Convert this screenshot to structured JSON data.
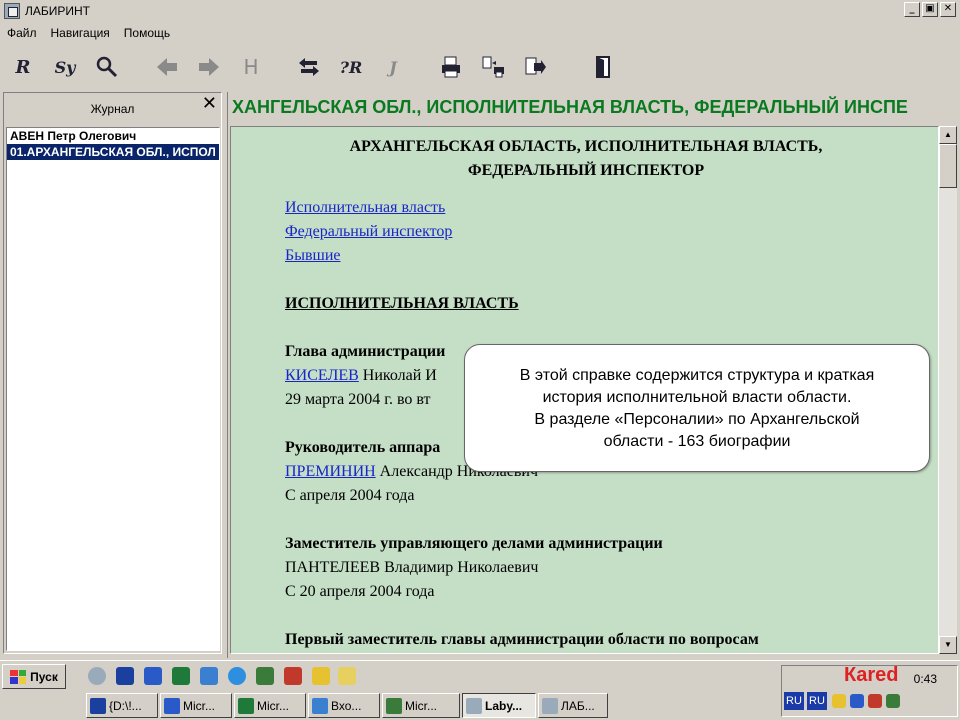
{
  "window": {
    "title": "ЛАБИРИНТ",
    "min": "_",
    "max": "▣",
    "close": "✕"
  },
  "menu": [
    "Файл",
    "Навигация",
    "Помощь"
  ],
  "toolbar": {
    "r": "R",
    "sy": "Sy",
    "h": "H",
    "qr": "?R",
    "j": "J"
  },
  "journal": {
    "title": "Журнал",
    "close": "✕",
    "items": [
      "АВЕН Петр Олегович",
      "01.АРХАНГЕЛЬСКАЯ ОБЛ., ИСПОЛ"
    ]
  },
  "header_text": "ХАНГЕЛЬСКАЯ ОБЛ., ИСПОЛНИТЕЛЬНАЯ ВЛАСТЬ, ФЕДЕРАЛЬНЫЙ ИНСПЕ",
  "document": {
    "title_line1": "АРХАНГЕЛЬСКАЯ ОБЛАСТЬ, ИСПОЛНИТЕЛЬНАЯ ВЛАСТЬ,",
    "title_line2": "ФЕДЕРАЛЬНЫЙ ИНСПЕКТОР",
    "links": [
      "Исполнительная власть",
      "Федеральный инспектор",
      "Бывшие"
    ],
    "section": "ИСПОЛНИТЕЛЬНАЯ ВЛАСТЬ",
    "entries": [
      {
        "role": "Глава администрации",
        "surname": "КИСЕЛЕВ",
        "name": " Николай И",
        "date": "29 марта 2004 г. во вт"
      },
      {
        "role": "Руководитель аппара",
        "surname": "ПРЕМИНИН",
        "name": " Александр Николаевич",
        "date": "С апреля 2004 года"
      },
      {
        "role": "Заместитель управляющего делами администрации",
        "surname": "ПАНТЕЛЕЕВ",
        "name": " Владимир Николаевич",
        "date": "С 20 апреля 2004 года"
      }
    ],
    "last_role": "Первый заместитель главы администрации области по вопросам"
  },
  "callout": [
    "В этой справке содержится структура и краткая",
    "история исполнительной власти области.",
    "В разделе «Персоналии» по Архангельской",
    "области - 163 биографии"
  ],
  "taskbar": {
    "start": "Пуск",
    "tasks": [
      "{D:\\!...",
      "Micr...",
      "Micr...",
      "Вхо...",
      "Micr...",
      "Laby...",
      "ЛАБ..."
    ],
    "time": "0:43",
    "lang": [
      "RU",
      "RU"
    ]
  },
  "watermark": {
    "prefix": "",
    "brand": "Кared",
    "text": "Кared"
  }
}
